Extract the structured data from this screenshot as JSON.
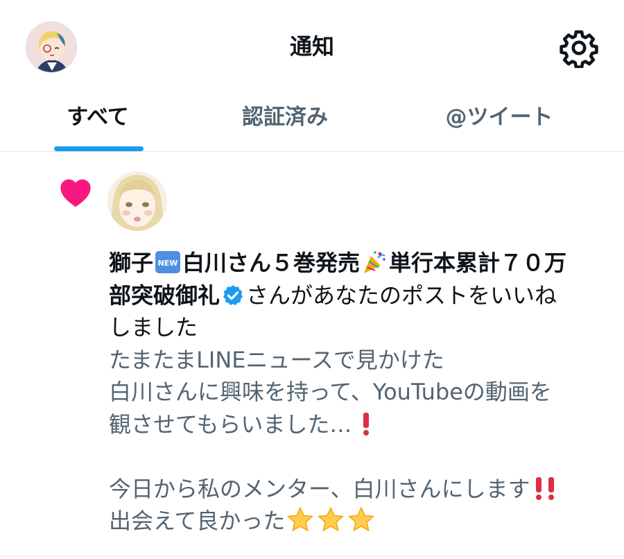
{
  "header": {
    "title": "通知",
    "avatar_icon": "user-avatar-icon",
    "settings_icon": "gear-icon"
  },
  "tabs": [
    {
      "label": "すべて",
      "active": true
    },
    {
      "label": "認証済み",
      "active": false
    },
    {
      "label": "@ツイート",
      "active": false
    }
  ],
  "notification": {
    "type_icon": "heart-icon",
    "liker_avatar_icon": "user-avatar-icon",
    "name_part1": "獅子",
    "new_badge": "NEW",
    "name_part2": "白川さん５巻発売",
    "name_part3": "単行本累計７０万",
    "name_part4": "部突破御礼",
    "verified_icon": "verified-badge-icon",
    "action_part1": "さんがあなたのポストをいいね",
    "action_part2": "しました",
    "quote_lines": [
      "たまたまLINEニュースで見かけた",
      "白川さんに興味を持って、YouTubeの動画を",
      "観させてもらいました…",
      "今日から私のメンター、白川さんにします",
      "出会えて良かった"
    ]
  },
  "colors": {
    "accent": "#1d9bf0",
    "heart": "#f91880",
    "secondary_text": "#536471"
  }
}
